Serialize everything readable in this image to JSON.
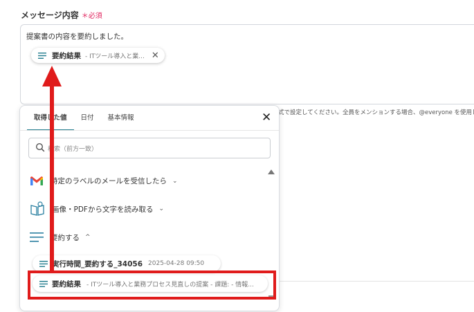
{
  "field": {
    "label": "メッセージ内容",
    "required": "＊必須"
  },
  "editor": {
    "text": "提案書の内容を要約しました。",
    "chip": {
      "name": "要約結果",
      "desc": "- ITツール導入と業..."
    }
  },
  "hint": "式で設定してください。全員をメンションする場合、@everyone を使用しま",
  "panel": {
    "tabs": [
      "取得した値",
      "日付",
      "基本情報"
    ],
    "active_tab": "取得した値",
    "search_placeholder": "検索（前方一致）",
    "groups": [
      {
        "label": "特定のラベルのメールを受信したら",
        "icon": "gmail-icon",
        "expanded": false
      },
      {
        "label": "画像・PDFから文字を読み取る",
        "icon": "ocr-book-icon",
        "expanded": false
      },
      {
        "label": "要約する",
        "icon": "summary-lines-icon",
        "expanded": true
      }
    ],
    "items": [
      {
        "name": "実行時間_要約する_34056",
        "desc": "2025-04-28 09:50"
      },
      {
        "name": "要約結果",
        "desc": "- ITツール導入と業務プロセス見直しの提案 - 課題: - 情報..."
      }
    ]
  },
  "colors": {
    "accent": "#1f7a8c",
    "annotation": "#e01b1b",
    "required": "#e0245e"
  }
}
